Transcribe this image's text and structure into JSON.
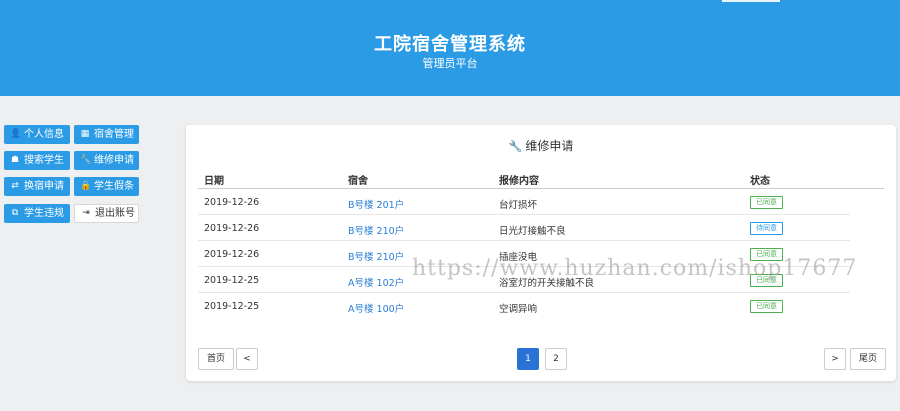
{
  "header": {
    "title": "工院宿舍管理系统",
    "subtitle": "管理员平台"
  },
  "sidebar": {
    "items": [
      {
        "label": "个人信息",
        "icon": "user-icon"
      },
      {
        "label": "宿舍管理",
        "icon": "building-icon"
      },
      {
        "label": "搜索学生",
        "icon": "student-icon"
      },
      {
        "label": "维修申请",
        "icon": "wrench-icon"
      },
      {
        "label": "换宿申请",
        "icon": "swap-icon"
      },
      {
        "label": "学生假条",
        "icon": "lock-icon"
      },
      {
        "label": "学生违规",
        "icon": "copy-icon"
      },
      {
        "label": "退出账号",
        "icon": "exit-icon"
      }
    ]
  },
  "main": {
    "title": "维修申请",
    "columns": [
      "日期",
      "宿舍",
      "报修内容",
      "状态"
    ],
    "rows": [
      {
        "date": "2019-12-26",
        "dorm": "B号楼 201户",
        "content": "台灯损坏",
        "status": "已同意",
        "status_color": "green"
      },
      {
        "date": "2019-12-26",
        "dorm": "B号楼 210户",
        "content": "日光灯接触不良",
        "status": "待同意",
        "status_color": "blue"
      },
      {
        "date": "2019-12-26",
        "dorm": "B号楼 210户",
        "content": "插座没电",
        "status": "已同意",
        "status_color": "green"
      },
      {
        "date": "2019-12-25",
        "dorm": "A号楼 102户",
        "content": "浴室灯的开关接触不良",
        "status": "已同意",
        "status_color": "green"
      },
      {
        "date": "2019-12-25",
        "dorm": "A号楼 100户",
        "content": "空调异响",
        "status": "已同意",
        "status_color": "green"
      }
    ],
    "pagination": {
      "first": "首页",
      "prev": "<",
      "pages": [
        "1",
        "2"
      ],
      "current": "1",
      "next": ">",
      "last": "尾页"
    }
  },
  "watermark": "https://www.huzhan.com/ishop17677",
  "colors": {
    "primary": "#2b9be5",
    "status_green": "#4caf50",
    "link": "#2b7fd6"
  }
}
